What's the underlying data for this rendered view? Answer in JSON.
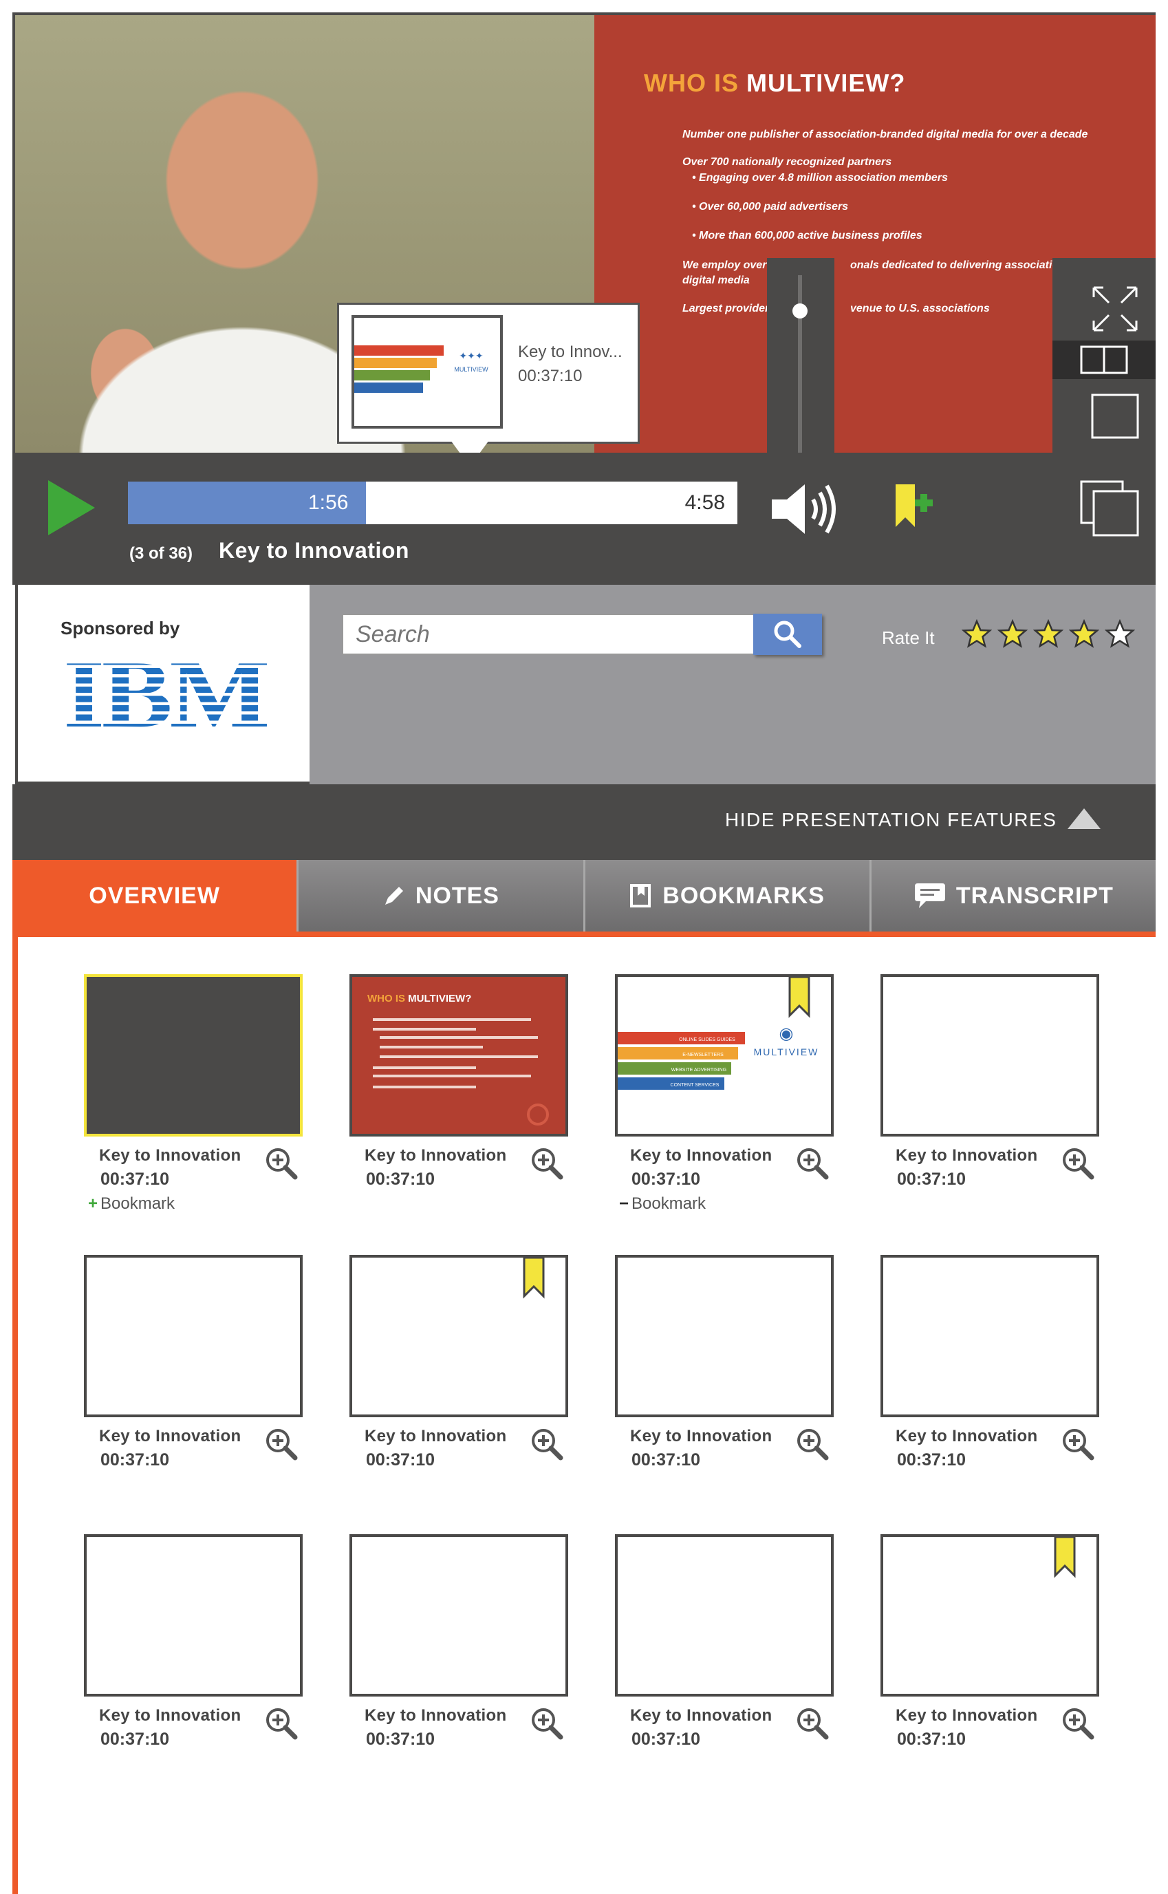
{
  "player": {
    "slide": {
      "title_accent": "WHO IS",
      "title_main": "MULTIVIEW?",
      "lines": [
        "Number one publisher of association-branded digital media for over a decade",
        "Over 700 nationally recognized partners",
        "• Engaging over 4.8 million association members",
        "• Over 60,000 paid advertisers",
        "• More than 600,000 active business profiles",
        "We employ over",
        "onals dedicated to delivering association",
        "digital media",
        "Largest provider",
        "venue to U.S. associations"
      ]
    },
    "tooltip": {
      "title": "Key to Innov...",
      "time": "00:37:10"
    },
    "volume_level": 0.8,
    "progress_fraction": 0.39,
    "current_time": "1:56",
    "total_time": "4:58",
    "slide_count": "(3 of 36)",
    "slide_name": "Key to Innovation",
    "colors": {
      "accent": "#ee5a2a",
      "play": "#3fa83a",
      "progress": "#6488c8",
      "bookmark": "#f3e43c"
    }
  },
  "sponsor": {
    "label": "Sponsored by",
    "logo_text": "IBM"
  },
  "search": {
    "placeholder": "Search",
    "rate_label": "Rate It",
    "rating": 4,
    "max_rating": 5
  },
  "hide_features_label": "HIDE PRESENTATION FEATURES",
  "tabs": [
    {
      "label": "OVERVIEW",
      "icon": "none",
      "active": true
    },
    {
      "label": "NOTES",
      "icon": "pencil-icon",
      "active": false
    },
    {
      "label": "BOOKMARKS",
      "icon": "bookmark-icon",
      "active": false
    },
    {
      "label": "TRANSCRIPT",
      "icon": "speech-bubble-icon",
      "active": false
    }
  ],
  "thumbnails": [
    {
      "title": "Key to Innovation",
      "time": "00:37:10",
      "bookmark_action": "Bookmark",
      "bookmark_sign": "+"
    },
    {
      "title": "Key to Innovation",
      "time": "00:37:10"
    },
    {
      "title": "Key to Innovation",
      "time": "00:37:10",
      "bookmark_action": "Bookmark",
      "bookmark_sign": "−"
    },
    {
      "title": "Key to Innovation",
      "time": "00:37:10"
    },
    {
      "title": "Key to Innovation",
      "time": "00:37:10"
    },
    {
      "title": "Key to Innovation",
      "time": "00:37:10"
    },
    {
      "title": "Key to Innovation",
      "time": "00:37:10"
    },
    {
      "title": "Key to Innovation",
      "time": "00:37:10"
    },
    {
      "title": "Key to Innovation",
      "time": "00:37:10"
    },
    {
      "title": "Key to Innovation",
      "time": "00:37:10"
    },
    {
      "title": "Key to Innovation",
      "time": "00:37:10"
    },
    {
      "title": "Key to Innovation",
      "time": "00:37:10"
    }
  ],
  "mini_slide": {
    "logo_text": "MULTIVIEW",
    "bands": [
      "ONLINE SLIDES GUIDES",
      "E-NEWSLETTERS",
      "WEBSITE ADVERTISING",
      "CONTENT SERVICES"
    ]
  }
}
